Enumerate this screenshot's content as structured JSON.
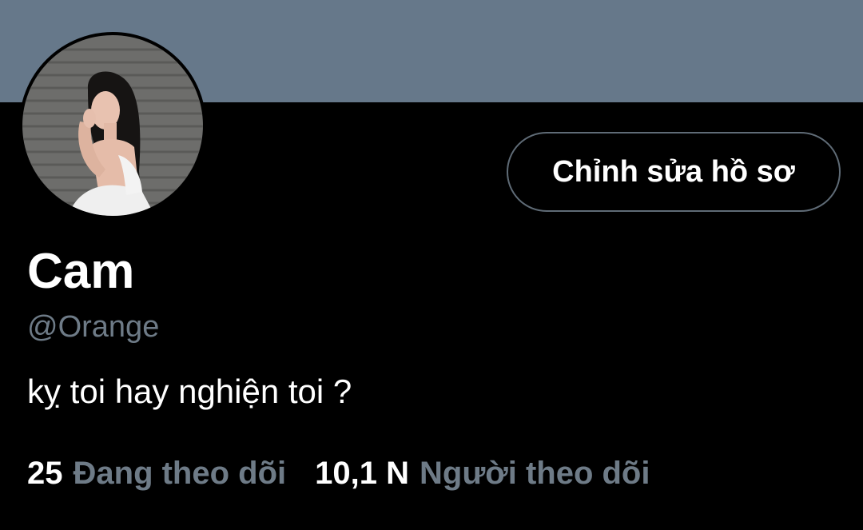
{
  "profile": {
    "display_name": "Cam",
    "handle": "@Orange",
    "bio": "kỵ toi hay nghiện toi ?",
    "avatar_icon": "profile-photo"
  },
  "actions": {
    "edit_profile_label": "Chỉnh sửa hồ sơ"
  },
  "stats": {
    "following_count": "25",
    "following_label": "Đang theo dõi",
    "followers_count": "10,1 N",
    "followers_label": "Người theo dõi"
  },
  "colors": {
    "banner": "#66788a",
    "background": "#000000",
    "secondary_text": "#6e7b87",
    "button_border": "#5f6b76"
  }
}
